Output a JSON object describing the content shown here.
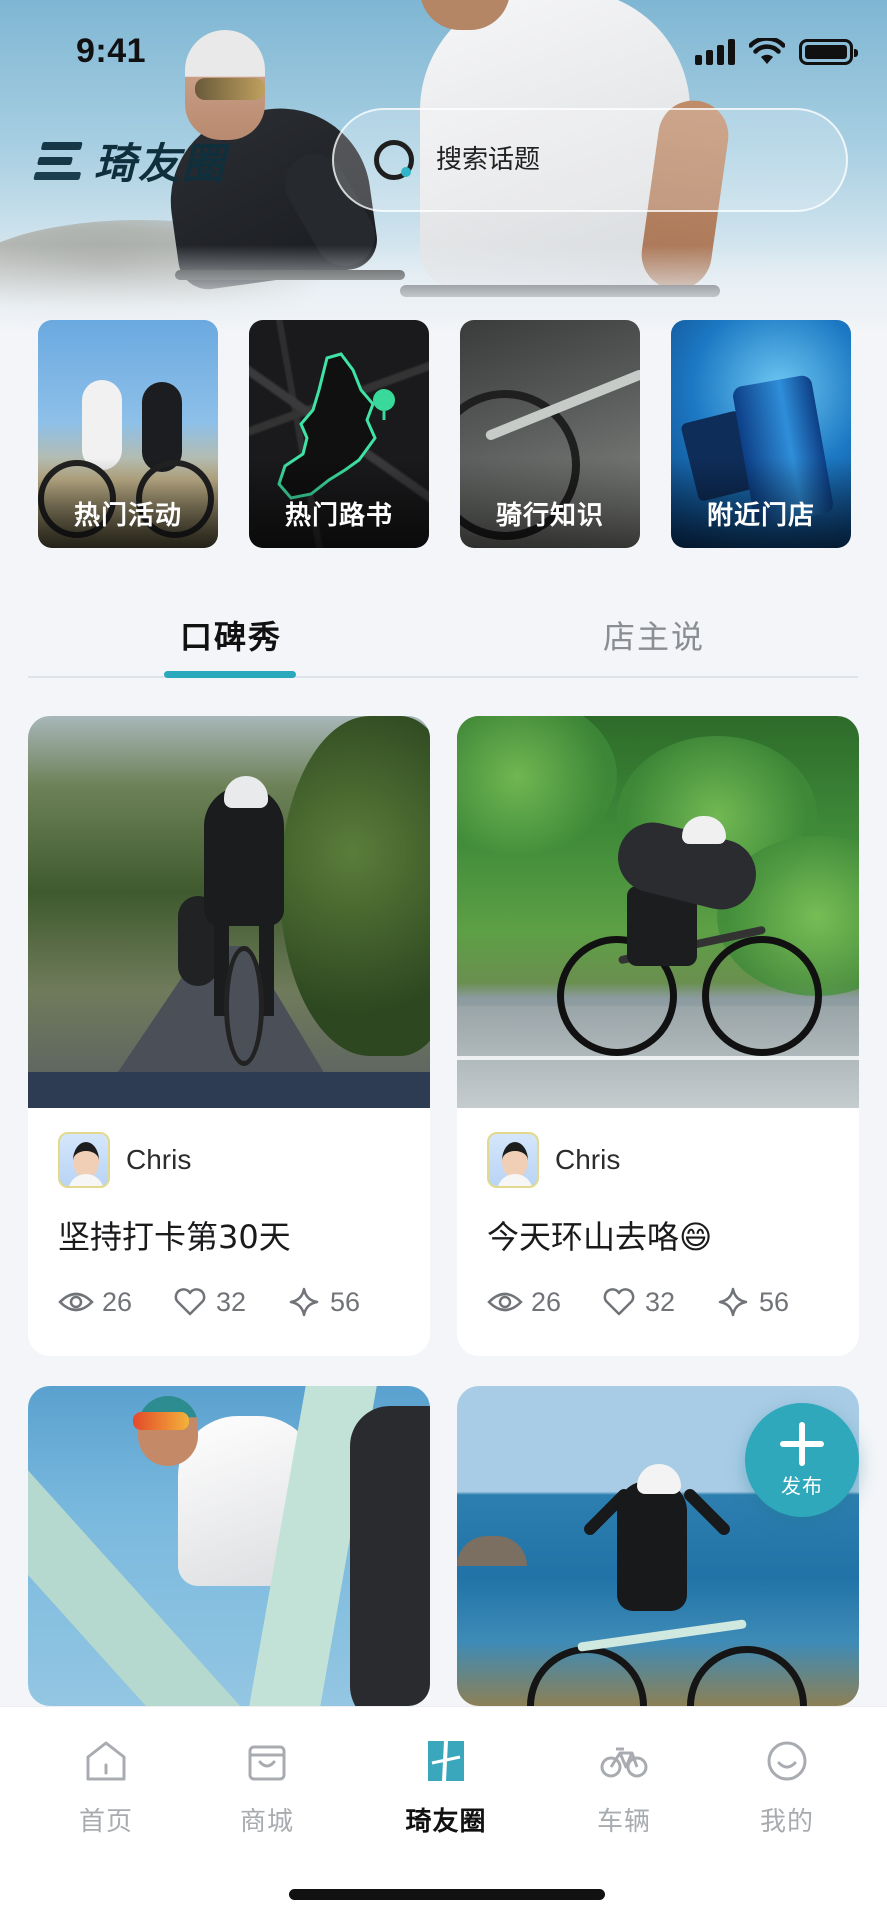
{
  "status_bar": {
    "time": "9:41"
  },
  "header": {
    "logo_text": "琦友圈",
    "search": {
      "placeholder": "搜索话题"
    }
  },
  "quick_entries": [
    {
      "label": "热门活动",
      "icon": "cyclists-photo"
    },
    {
      "label": "热门路书",
      "icon": "route-map"
    },
    {
      "label": "骑行知识",
      "icon": "bike-photo"
    },
    {
      "label": "附近门店",
      "icon": "store-photo"
    }
  ],
  "tabs": [
    {
      "label": "口碑秀",
      "active": true
    },
    {
      "label": "店主说",
      "active": false
    }
  ],
  "feed": [
    {
      "author": "Chris",
      "title": "坚持打卡第30天",
      "views": "26",
      "likes": "32",
      "favorites": "56"
    },
    {
      "author": "Chris",
      "title": "今天环山去咯😄",
      "views": "26",
      "likes": "32",
      "favorites": "56"
    },
    {
      "author": "",
      "title": ""
    },
    {
      "author": "",
      "title": ""
    }
  ],
  "fab": {
    "label": "发布"
  },
  "bottom_nav": [
    {
      "label": "首页",
      "icon": "home-icon",
      "active": false
    },
    {
      "label": "商城",
      "icon": "shopping-bag-icon",
      "active": false
    },
    {
      "label": "琦友圈",
      "icon": "community-icon",
      "active": true
    },
    {
      "label": "车辆",
      "icon": "bicycle-icon",
      "active": false
    },
    {
      "label": "我的",
      "icon": "smile-icon",
      "active": false
    }
  ],
  "colors": {
    "accent": "#2fa8bb",
    "tab_indicator": "#2aa9bd",
    "text_dark": "#111111",
    "text_muted": "#a8acb0"
  }
}
